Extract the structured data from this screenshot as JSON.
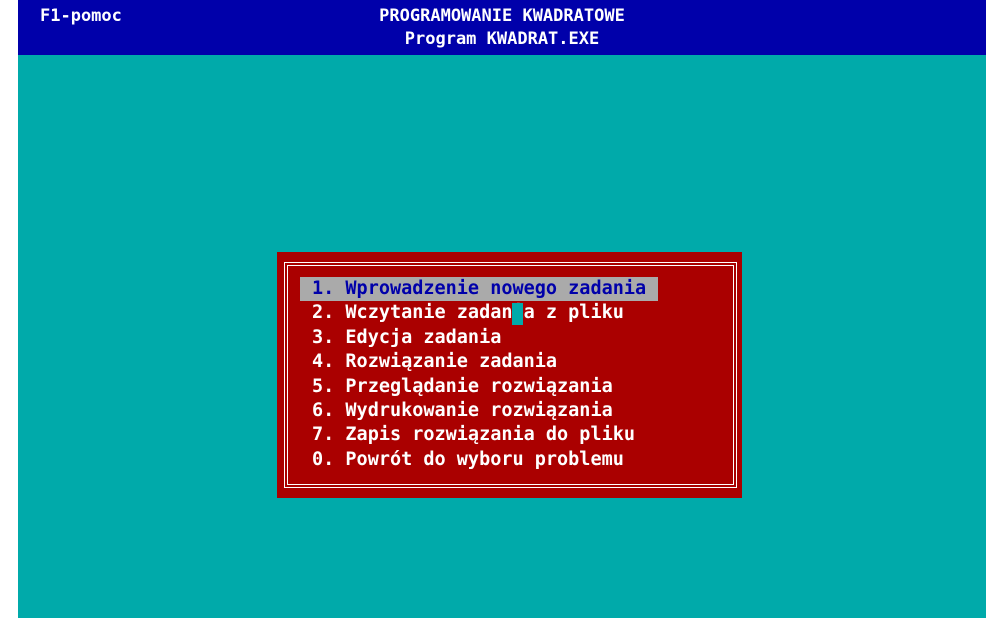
{
  "title_bar": {
    "help_hint": "F1-pomoc",
    "title": "PROGRAMOWANIE KWADRATOWE",
    "subtitle": "Program KWADRAT.EXE"
  },
  "colors": {
    "screen_background": "#00aaaa",
    "title_bar_background": "#0000aa",
    "menu_background": "#aa0000",
    "menu_text": "#ffffff",
    "selection_background": "#aaaaaa",
    "selection_text": "#0000aa"
  },
  "menu": {
    "selected_index": 0,
    "items": [
      {
        "label": "1. Wprowadzenie nowego zadania"
      },
      {
        "label": "2. Wczytanie zadania z pliku"
      },
      {
        "label": "3. Edycja zadania"
      },
      {
        "label": "4. Rozwiązanie zadania"
      },
      {
        "label": "5. Przeglądanie rozwiązania"
      },
      {
        "label": "6. Wydrukowanie rozwiązania"
      },
      {
        "label": "7. Zapis rozwiązania do pliku"
      },
      {
        "label": "0. Powrót do wyboru problemu"
      }
    ]
  }
}
